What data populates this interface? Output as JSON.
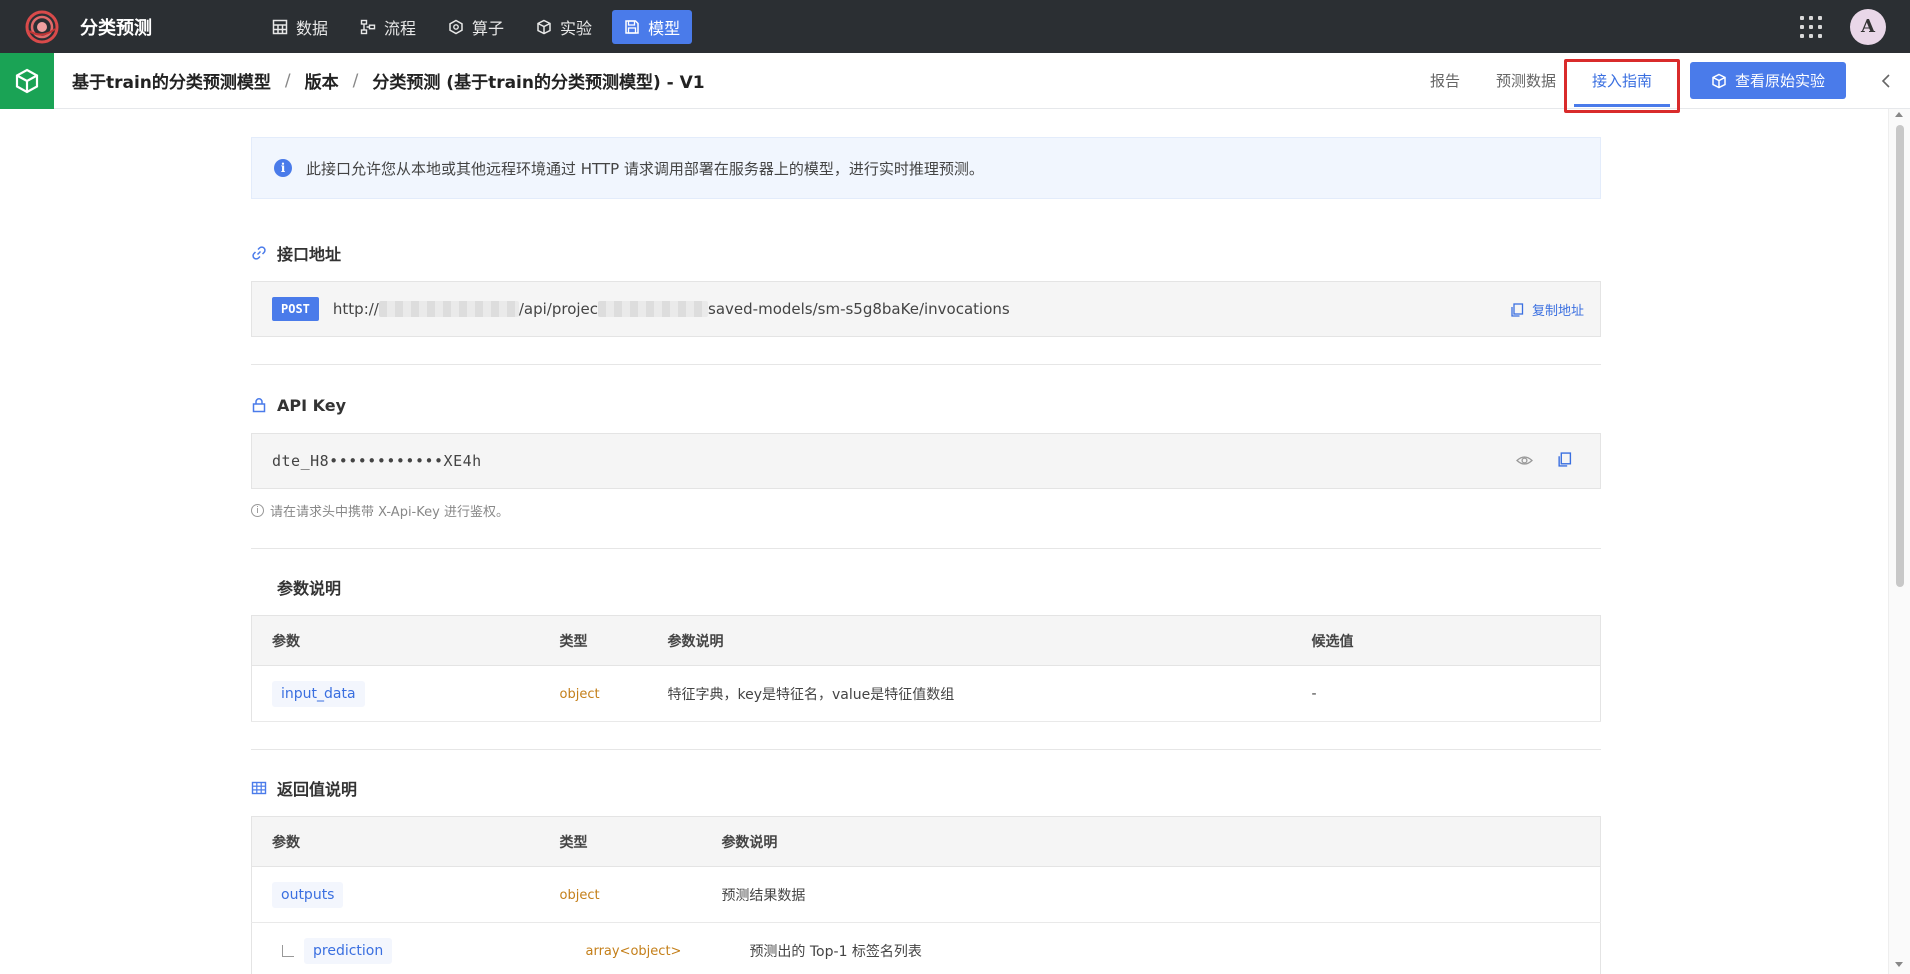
{
  "app": {
    "title": "分类预测"
  },
  "nav": {
    "items": [
      {
        "label": "数据",
        "icon": "table-icon"
      },
      {
        "label": "流程",
        "icon": "flow-icon"
      },
      {
        "label": "算子",
        "icon": "hexagon-icon"
      },
      {
        "label": "实验",
        "icon": "cube-icon"
      },
      {
        "label": "模型",
        "icon": "save-icon",
        "active": true
      }
    ]
  },
  "user": {
    "avatar_letter": "A"
  },
  "breadcrumb": {
    "model": "基于train的分类预测模型",
    "sep": "/",
    "versions": "版本",
    "current": "分类预测 (基于train的分类预测模型) - V1"
  },
  "tabs": [
    {
      "label": "报告"
    },
    {
      "label": "预测数据"
    },
    {
      "label": "接入指南",
      "active": true
    }
  ],
  "view_original_button": "查看原始实验",
  "info_banner": "此接口允许您从本地或其他远程环境通过 HTTP 请求调用部署在服务器上的模型，进行实时推理预测。",
  "endpoint": {
    "title": "接口地址",
    "method": "POST",
    "url_prefix": "http://",
    "url_mid": "/api/projec",
    "url_suffix": "saved-models/sm-s5g8baKe/invocations",
    "copy_label": "复制地址"
  },
  "api_key": {
    "title": "API Key",
    "value": "dte_H8••••••••••••XE4h",
    "hint": "请在请求头中携带 X-Api-Key 进行鉴权。"
  },
  "params": {
    "title": "参数说明",
    "headers": [
      "参数",
      "类型",
      "参数说明",
      "候选值"
    ],
    "rows": [
      {
        "name": "input_data",
        "type": "object",
        "desc": "特征字典，key是特征名，value是特征值数组",
        "candidates": "-"
      }
    ]
  },
  "returns": {
    "title": "返回值说明",
    "headers": [
      "参数",
      "类型",
      "参数说明"
    ],
    "rows": [
      {
        "name": "outputs",
        "type": "object",
        "desc": "预测结果数据"
      },
      {
        "name": "prediction",
        "type": "array<object>",
        "desc": "预测出的 Top-1 标签名列表"
      }
    ]
  },
  "colors": {
    "topbar": "#2b2f33",
    "accent": "#4a7bea",
    "green": "#1aa355",
    "highlight": "#d92b2b"
  }
}
